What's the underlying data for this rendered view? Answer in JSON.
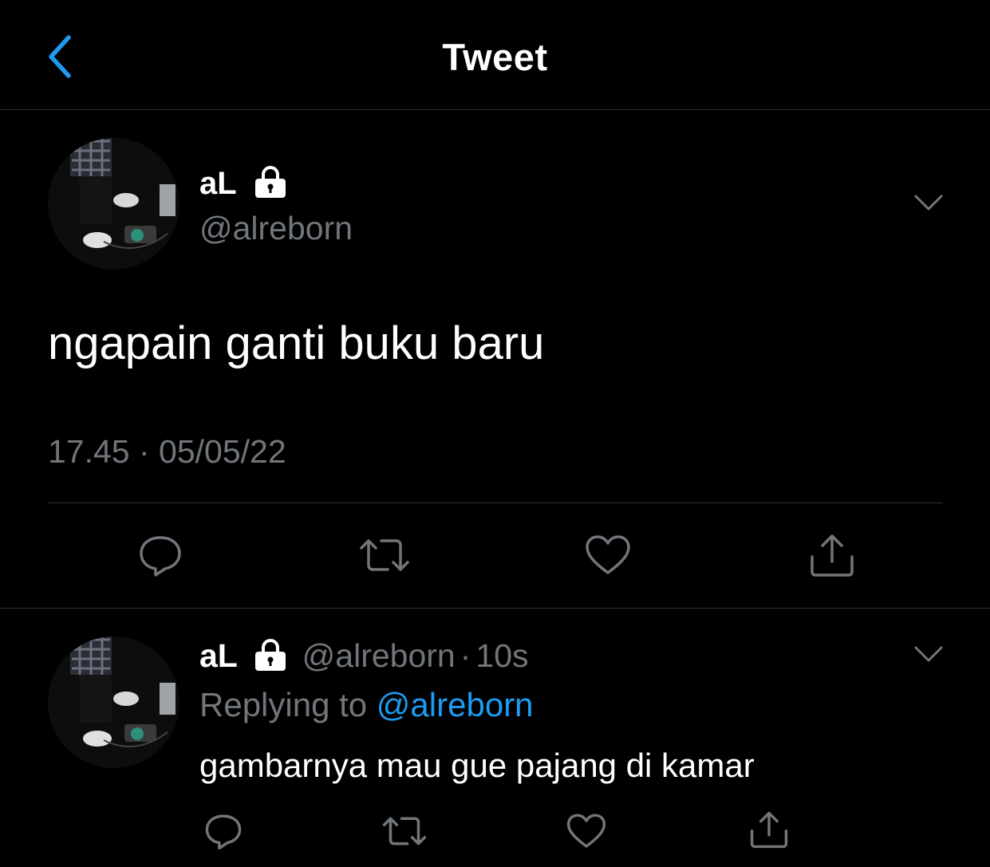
{
  "header": {
    "title": "Tweet",
    "back_icon": "chevron-left-icon"
  },
  "colors": {
    "background": "#000000",
    "text": "#ffffff",
    "muted": "#71767b",
    "accent": "#1d9bf0",
    "divider": "#2f3336"
  },
  "main_tweet": {
    "display_name": "aL",
    "protected_icon": "lock-icon",
    "handle": "@alreborn",
    "text": "ngapain ganti buku baru",
    "timestamp": "17.45 · 05/05/22",
    "menu_icon": "chevron-down-icon",
    "actions": [
      "reply-icon",
      "retweet-icon",
      "like-icon",
      "share-icon"
    ]
  },
  "reply_tweet": {
    "display_name": "aL",
    "protected_icon": "lock-icon",
    "handle": "@alreborn",
    "separator": "·",
    "time_ago": "10s",
    "replying_to_label": "Replying to",
    "replying_to_handle": "@alreborn",
    "text": "gambarnya mau gue pajang di kamar",
    "menu_icon": "chevron-down-icon",
    "actions": [
      "reply-icon",
      "retweet-icon",
      "like-icon",
      "share-icon"
    ]
  }
}
